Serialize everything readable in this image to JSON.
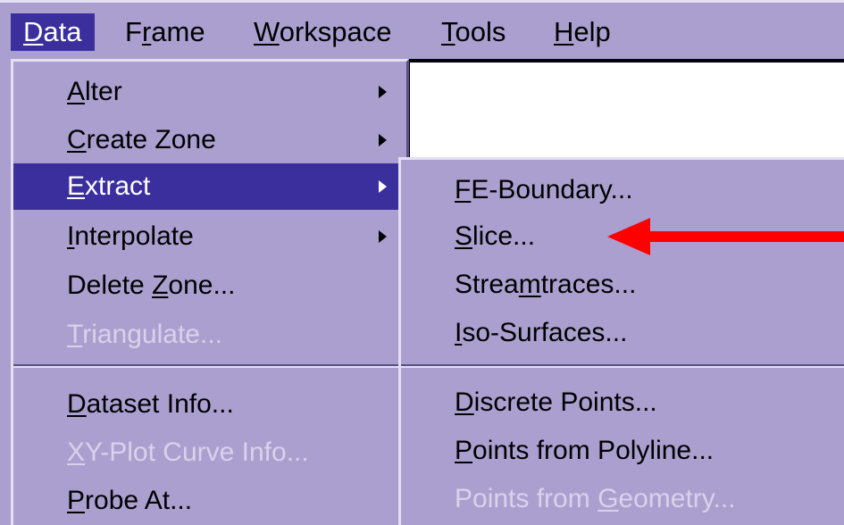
{
  "menubar": {
    "items": [
      {
        "pre": "",
        "ul": "D",
        "post": "ata"
      },
      {
        "pre": "F",
        "ul": "r",
        "post": "ame"
      },
      {
        "pre": "",
        "ul": "W",
        "post": "orkspace"
      },
      {
        "pre": "",
        "ul": "T",
        "post": "ools"
      },
      {
        "pre": "",
        "ul": "H",
        "post": "elp"
      }
    ]
  },
  "data_menu": {
    "items": [
      {
        "pre": "",
        "ul": "A",
        "post": "lter"
      },
      {
        "pre": "",
        "ul": "C",
        "post": "reate Zone"
      },
      {
        "pre": "",
        "ul": "E",
        "post": "xtract"
      },
      {
        "pre": "",
        "ul": "I",
        "post": "nterpolate"
      },
      {
        "pre": "Delete ",
        "ul": "Z",
        "post": "one..."
      },
      {
        "pre": "",
        "ul": "T",
        "post": "riangulate..."
      },
      {
        "pre": "",
        "ul": "D",
        "post": "ataset Info..."
      },
      {
        "pre": "",
        "ul": "X",
        "post": "Y-Plot Curve Info..."
      },
      {
        "pre": "",
        "ul": "P",
        "post": "robe At..."
      }
    ]
  },
  "extract_submenu": {
    "items": [
      {
        "pre": "",
        "ul": "F",
        "post": "E-Boundary..."
      },
      {
        "pre": "",
        "ul": "S",
        "post": "lice..."
      },
      {
        "pre": "Strea",
        "ul": "m",
        "post": "traces..."
      },
      {
        "pre": "",
        "ul": "I",
        "post": "so-Surfaces..."
      },
      {
        "pre": "",
        "ul": "D",
        "post": "iscrete Points..."
      },
      {
        "pre": "",
        "ul": "P",
        "post": "oints from Polyline..."
      },
      {
        "pre": "Points from ",
        "ul": "G",
        "post": "eometry..."
      }
    ]
  },
  "colors": {
    "menu_bg": "#ab9fd0",
    "highlight": "#3b2f9e",
    "annotation_arrow": "#ff0000"
  }
}
